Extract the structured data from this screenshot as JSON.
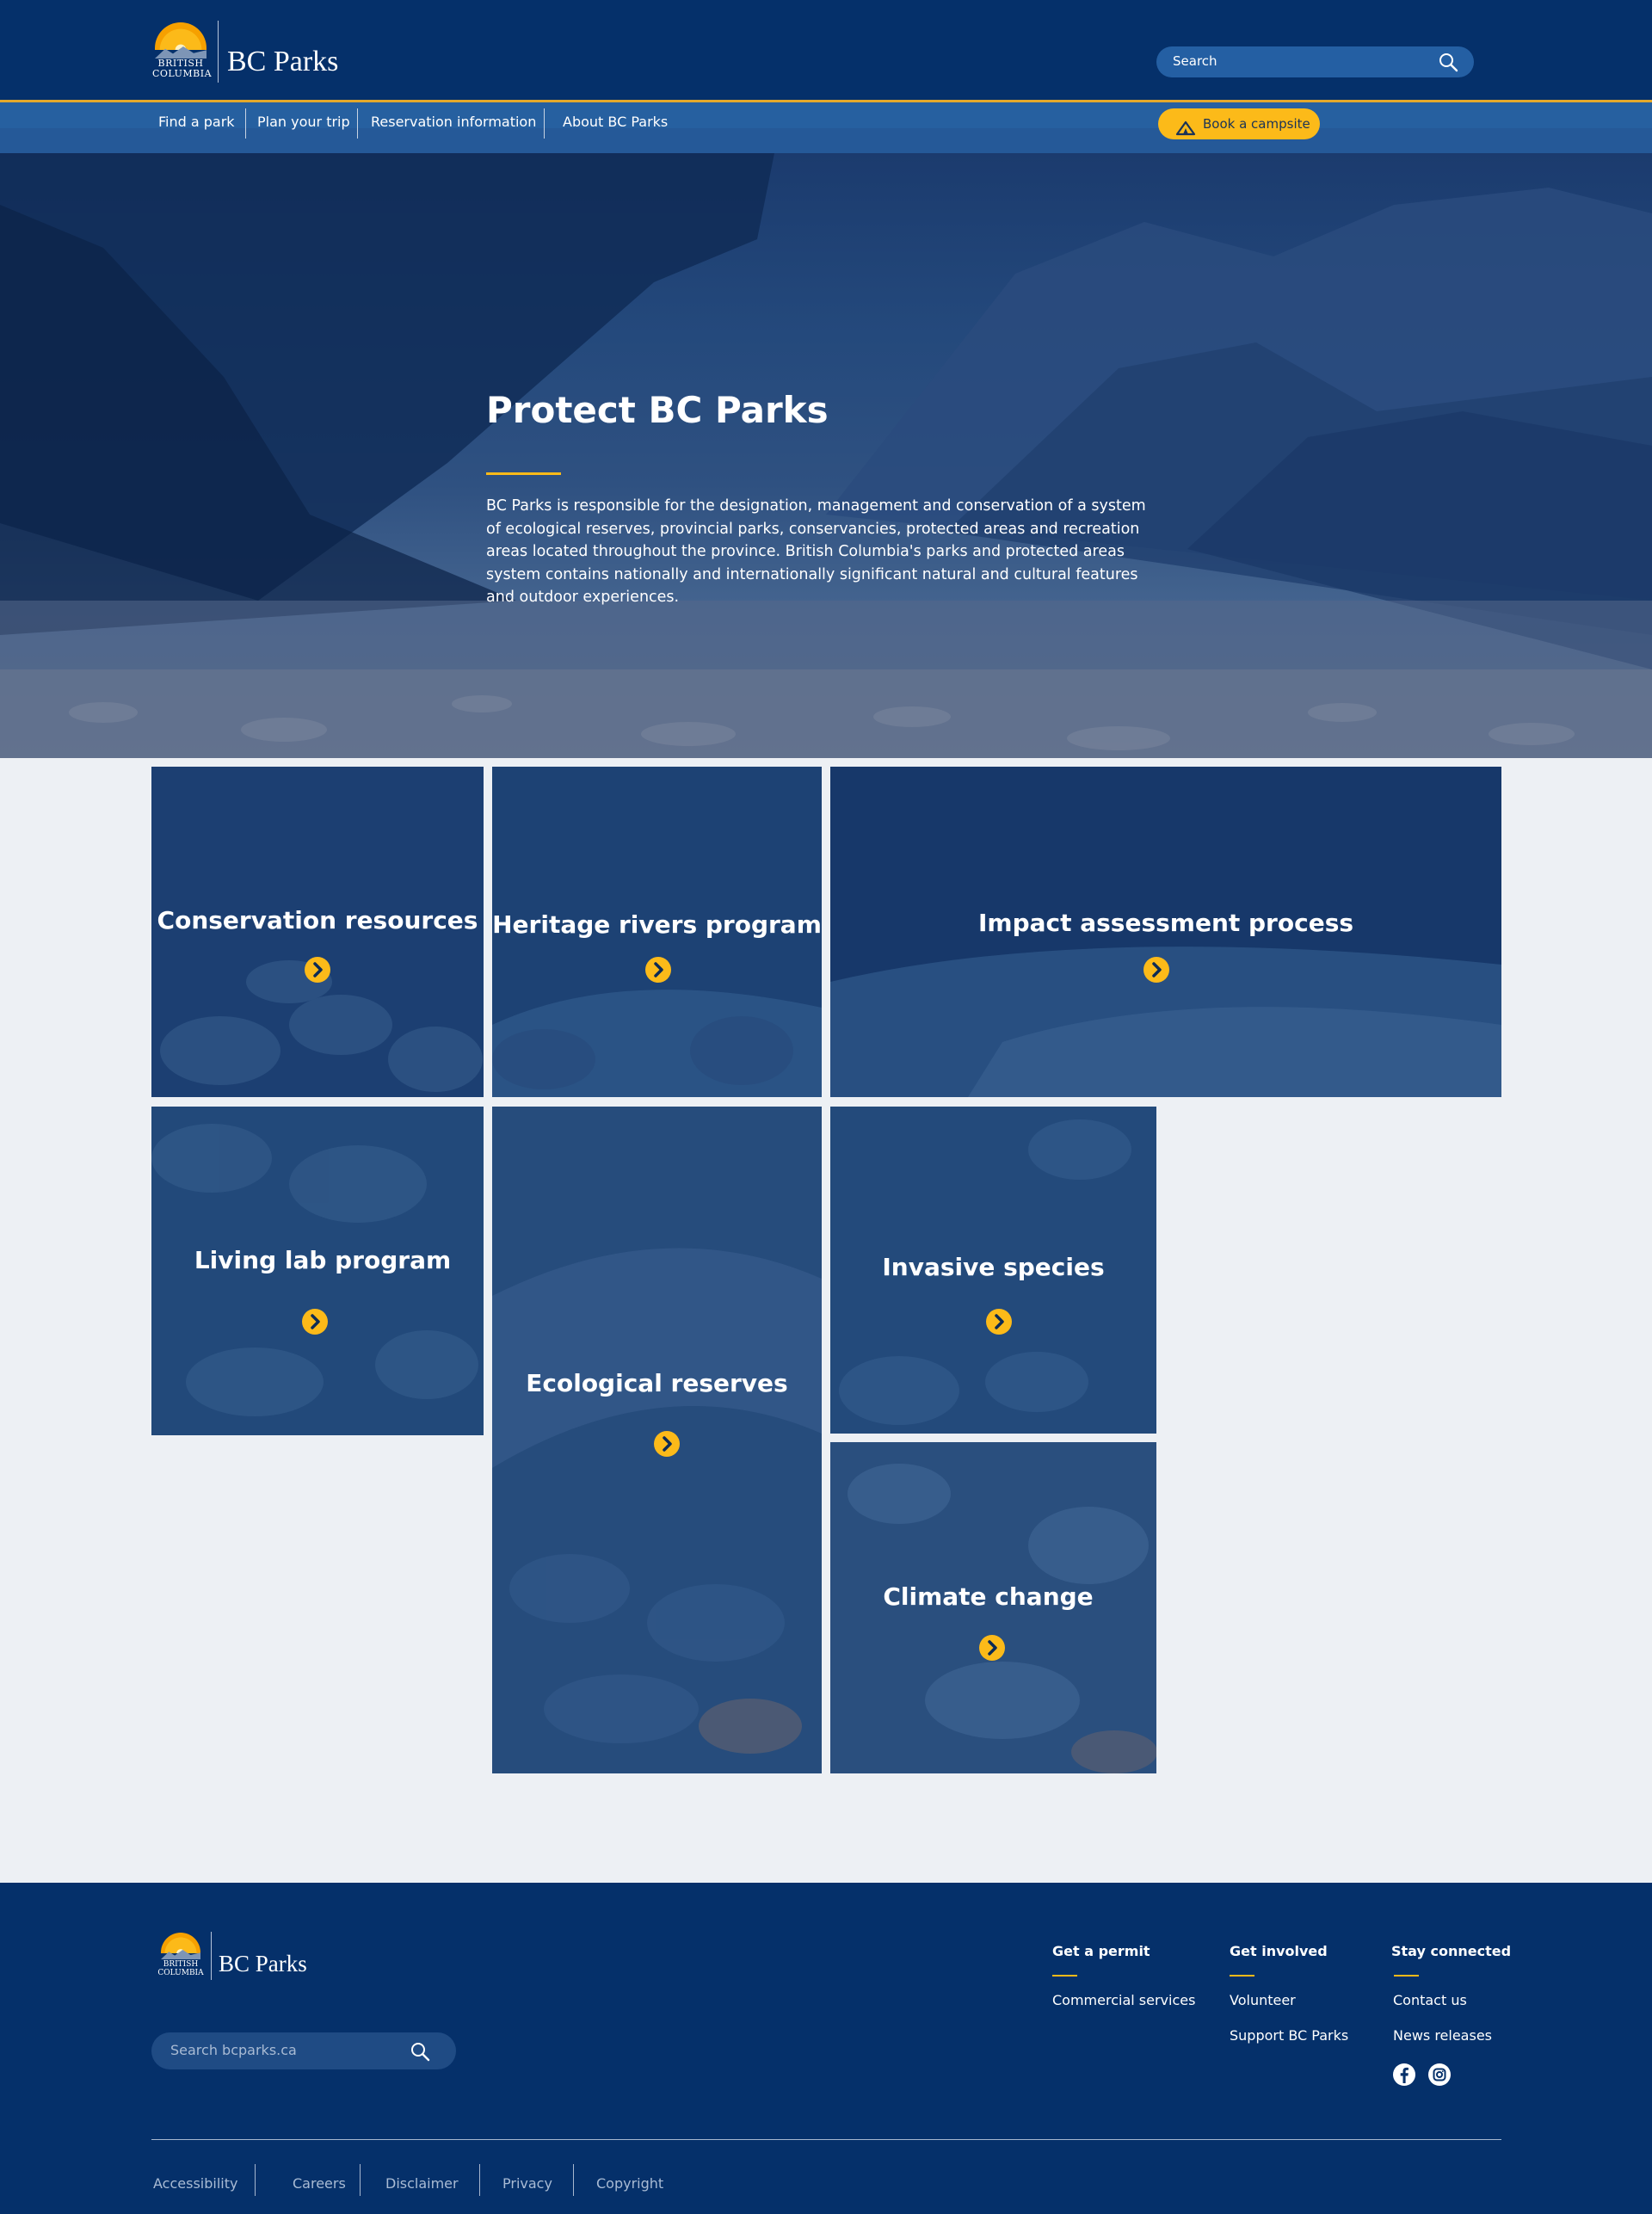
{
  "header": {
    "logo": {
      "province_line1": "BRITISH",
      "province_line2": "COLUMBIA",
      "name": "BC Parks"
    },
    "search_placeholder": "Search",
    "nav": [
      "Find a park",
      "Plan your trip",
      "Reservation information",
      "About BC Parks"
    ],
    "cta": "Book a campsite"
  },
  "hero": {
    "title": "Protect BC Parks",
    "body": "BC Parks is responsible for the designation, management and conservation of a system of ecological reserves, provincial parks, conservancies, protected areas and recreation areas located throughout the province. British Columbia's parks and protected areas system contains nationally and internationally significant natural and cultural features and outdoor experiences."
  },
  "tiles": [
    {
      "title": "Conservation resources"
    },
    {
      "title": "Heritage rivers program"
    },
    {
      "title": "Impact assessment process"
    },
    {
      "title": "Living lab program"
    },
    {
      "title": "Ecological reserves"
    },
    {
      "title": "Invasive species"
    },
    {
      "title": "Climate change"
    }
  ],
  "footer": {
    "logo": {
      "province_line1": "BRITISH",
      "province_line2": "COLUMBIA",
      "name": "BC Parks"
    },
    "search_placeholder": "Search bcparks.ca",
    "columns": [
      {
        "heading": "Get a permit",
        "links": [
          "Commercial services"
        ]
      },
      {
        "heading": "Get involved",
        "links": [
          "Volunteer",
          "Support BC Parks"
        ]
      },
      {
        "heading": "Stay connected",
        "links": [
          "Contact us",
          "News releases"
        ]
      }
    ],
    "social": [
      "facebook-icon",
      "instagram-icon"
    ],
    "bottom_links": [
      "Accessibility",
      "Careers",
      "Disclaimer",
      "Privacy",
      "Copyright"
    ]
  },
  "colors": {
    "navy": "#05306a",
    "nav_blue": "#2660a0",
    "gold": "#fcba19",
    "page_bg": "#edf0f4"
  }
}
